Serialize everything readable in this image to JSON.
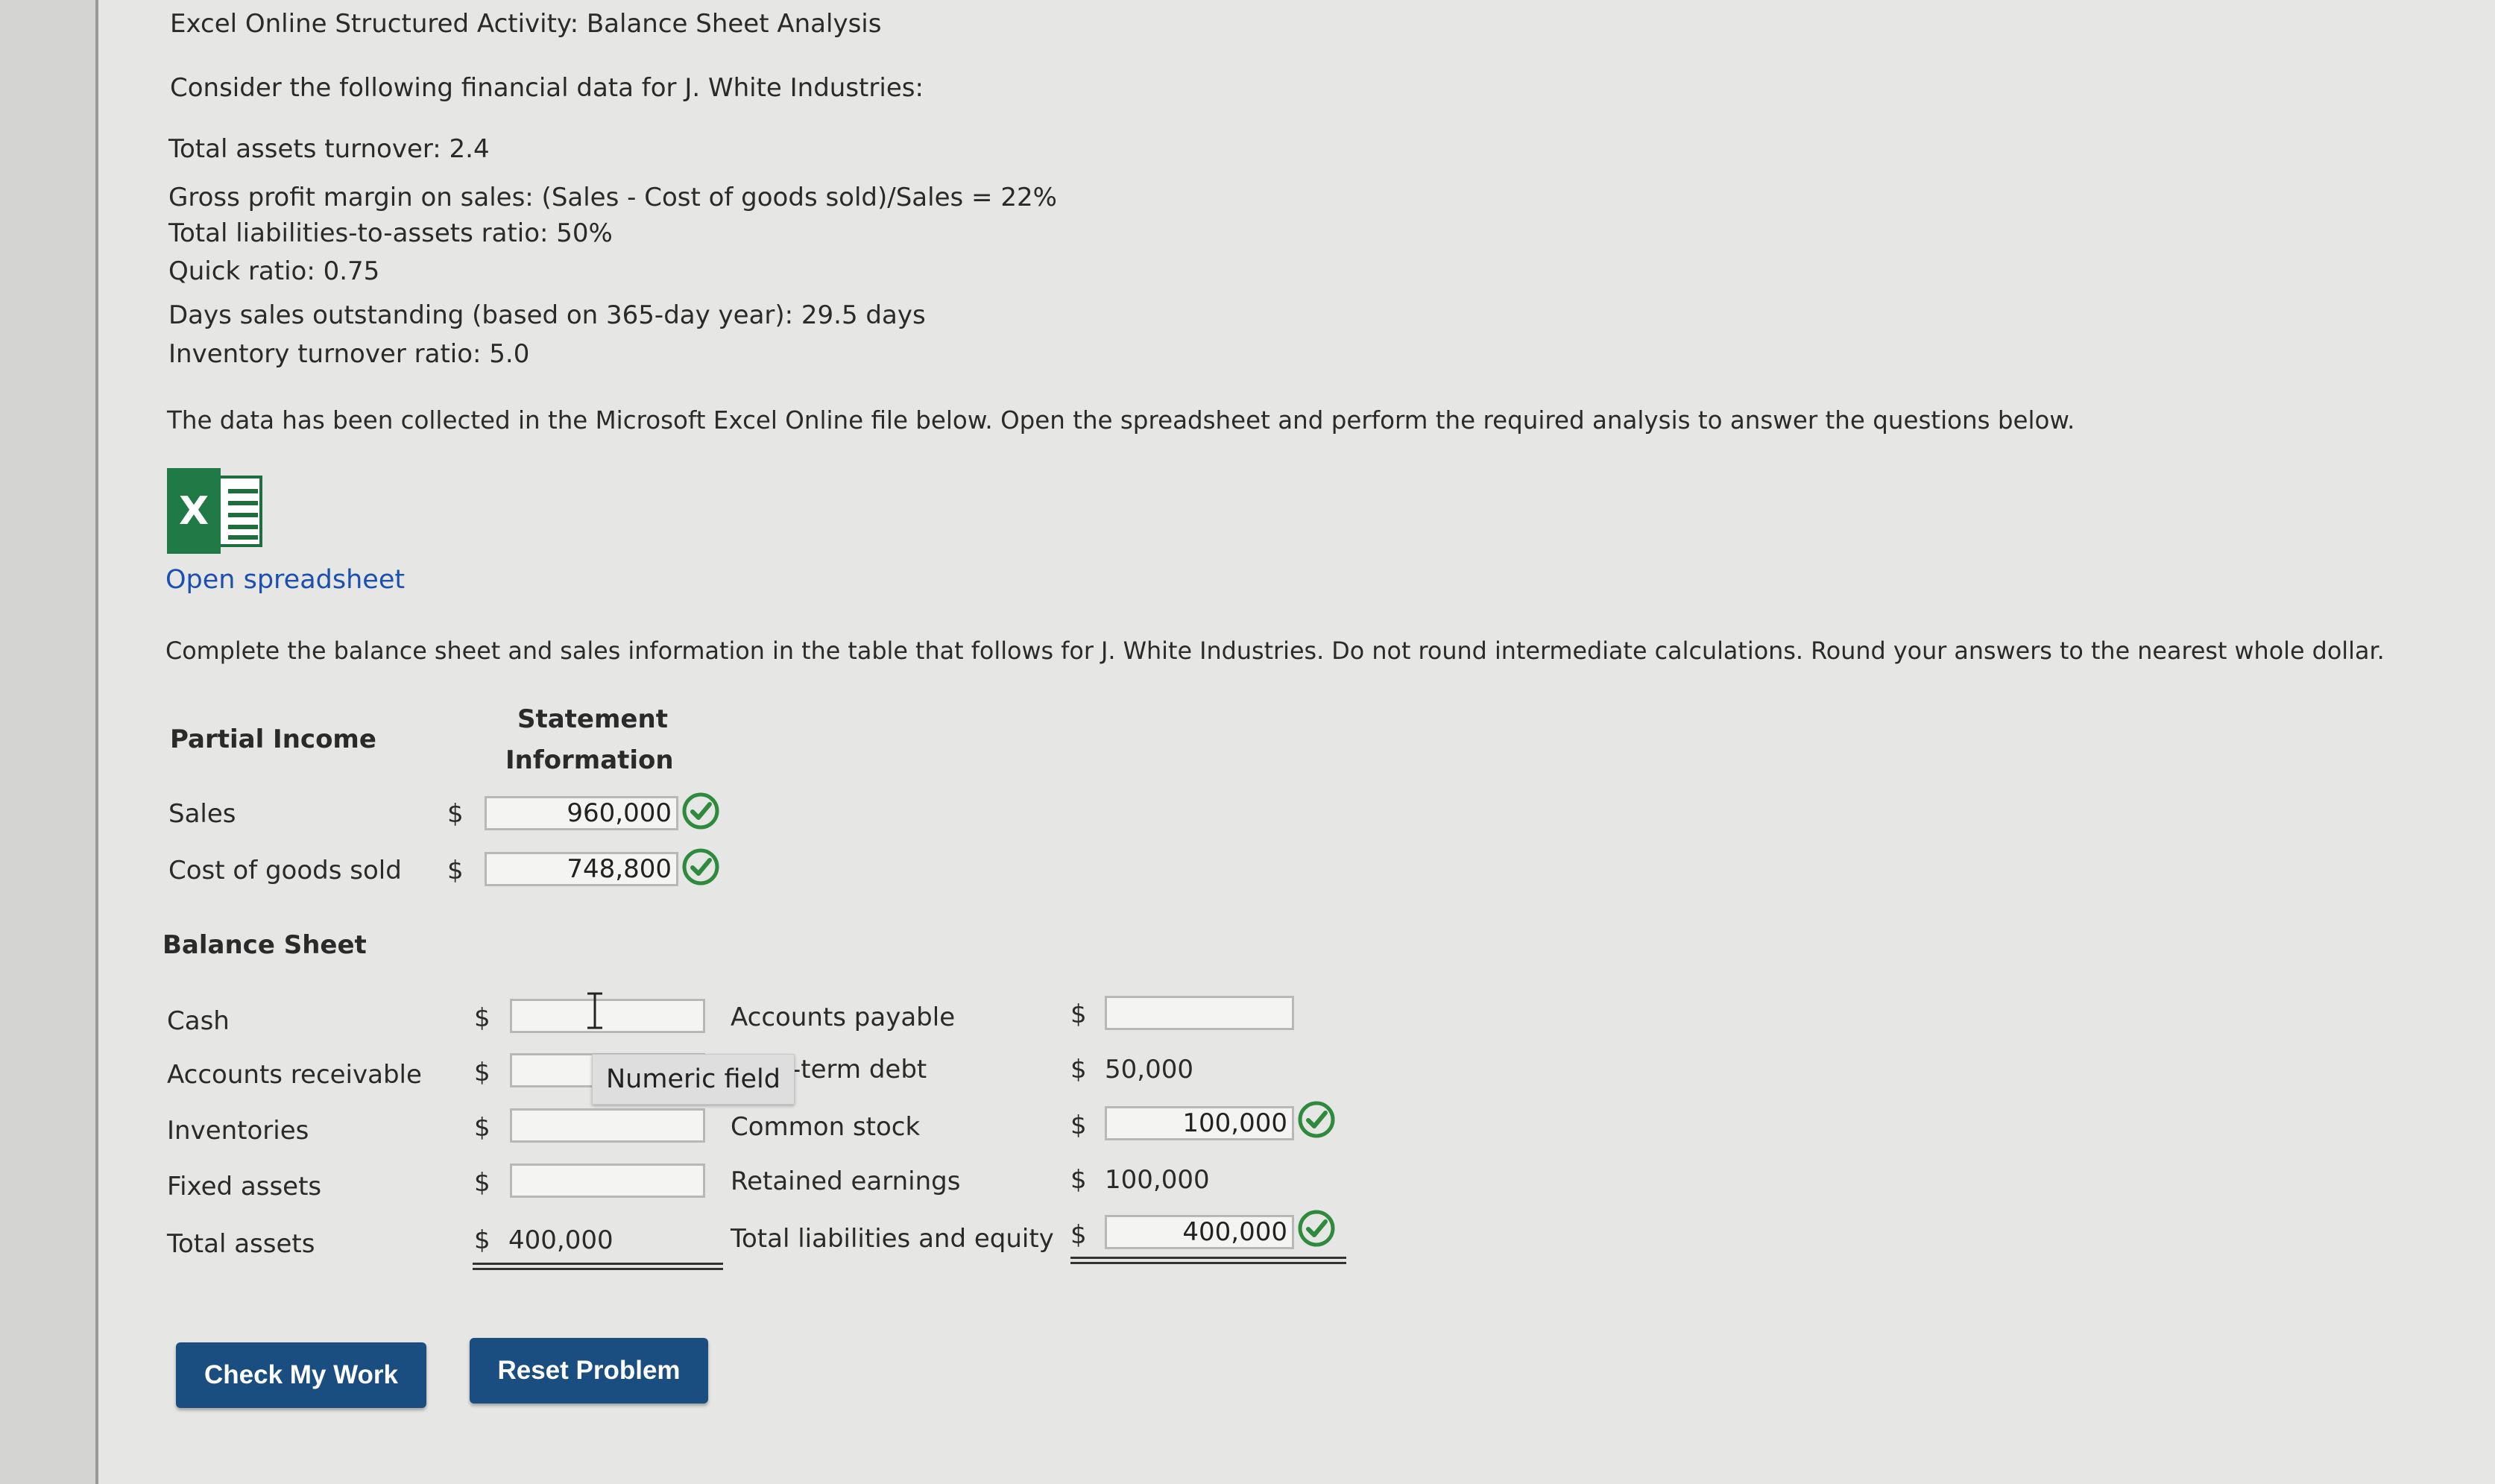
{
  "header": {
    "title": "Excel Online Structured Activity: Balance Sheet Analysis",
    "intro": "Consider the following financial data for J. White Industries:"
  },
  "financial_data": [
    "Total assets turnover: 2.4",
    "Gross profit margin on sales: (Sales - Cost of goods sold)/Sales = 22%",
    "Total liabilities-to-assets ratio: 50%",
    "Quick ratio: 0.75",
    "Days sales outstanding (based on 365-day year): 29.5 days",
    "Inventory turnover ratio: 5.0"
  ],
  "collected_note": "The data has been collected in the Microsoft Excel Online file below. Open the spreadsheet and perform the required analysis to answer the questions below.",
  "spreadsheet": {
    "icon": "excel-icon",
    "icon_letter": "X",
    "link_label": "Open spreadsheet"
  },
  "instruction": "Complete the balance sheet and sales information in the table that follows for J. White Industries. Do not round intermediate calculations. Round your answers to the nearest whole dollar.",
  "income": {
    "heading_left": "Partial Income",
    "heading_right_1": "Statement",
    "heading_right_2": "Information",
    "rows": [
      {
        "label": "Sales",
        "currency": "$",
        "value": "960,000",
        "status": "correct"
      },
      {
        "label": "Cost of goods sold",
        "currency": "$",
        "value": "748,800",
        "status": "correct"
      }
    ]
  },
  "balance": {
    "heading": "Balance Sheet",
    "assets": [
      {
        "label": "Cash",
        "currency": "$",
        "value": ""
      },
      {
        "label": "Accounts receivable",
        "currency": "$",
        "value": ""
      },
      {
        "label": "Inventories",
        "currency": "$",
        "value": ""
      },
      {
        "label": "Fixed assets",
        "currency": "$",
        "value": ""
      },
      {
        "label": "Total assets",
        "currency": "$",
        "value": "400,000"
      }
    ],
    "liabilities": [
      {
        "label": "Accounts payable",
        "currency": "$",
        "value": ""
      },
      {
        "label": "-term debt",
        "currency": "$",
        "value": "50,000"
      },
      {
        "label": "Common stock",
        "currency": "$",
        "value": "100,000",
        "status": "correct"
      },
      {
        "label": "Retained earnings",
        "currency": "$",
        "value": "100,000"
      },
      {
        "label": "Total liabilities and equity",
        "currency": "$",
        "value": "400,000",
        "status": "correct"
      }
    ]
  },
  "tooltip": "Numeric field",
  "buttons": {
    "check": "Check My Work",
    "reset": "Reset Problem"
  },
  "colors": {
    "button": "#1a4e80",
    "link": "#1b4fb0",
    "check": "#2f8a3e"
  }
}
